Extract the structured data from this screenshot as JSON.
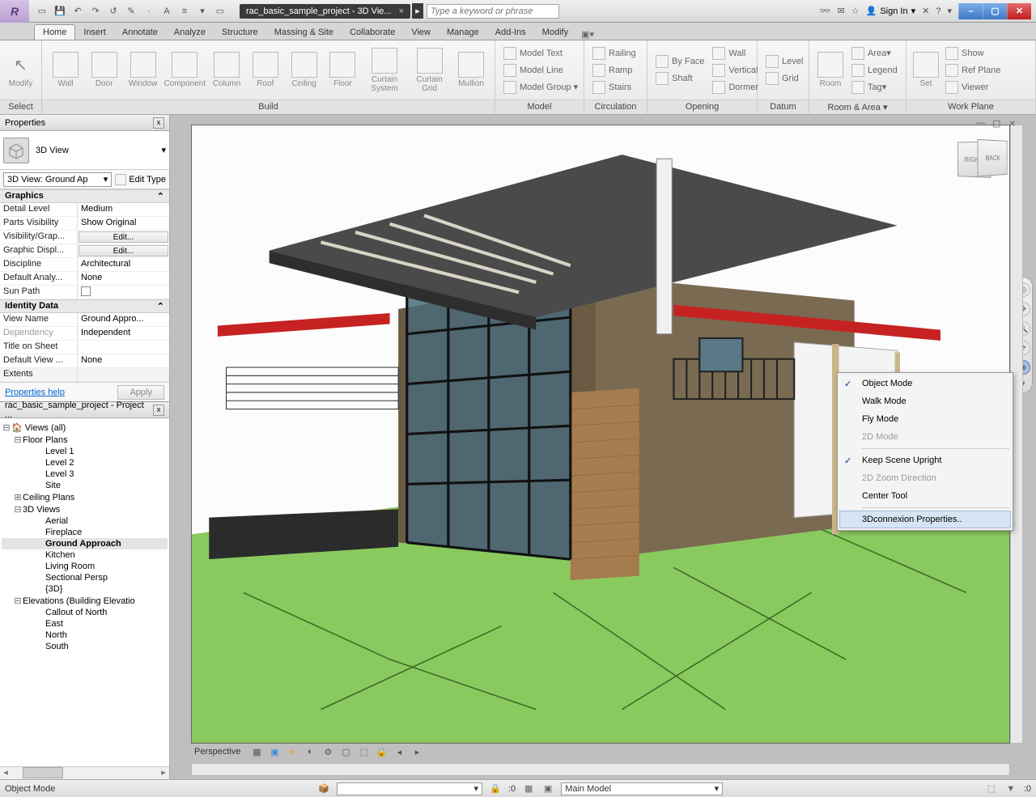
{
  "title_tab": "rac_basic_sample_project - 3D Vie...",
  "search_placeholder": "Type a keyword or phrase",
  "signin": "Sign In",
  "ribbon_tabs": [
    "Home",
    "Insert",
    "Annotate",
    "Analyze",
    "Structure",
    "Massing & Site",
    "Collaborate",
    "View",
    "Manage",
    "Add-Ins",
    "Modify"
  ],
  "ribbon": {
    "select": {
      "modify": "Modify",
      "title": "Select"
    },
    "build": {
      "title": "Build",
      "btns": [
        "Wall",
        "Door",
        "Window",
        "Component",
        "Column",
        "Roof",
        "Ceiling",
        "Floor",
        "Curtain System",
        "Curtain Grid",
        "Mullion"
      ]
    },
    "model": {
      "title": "Model",
      "model_text": "Model Text",
      "model_line": "Model Line",
      "model_group": "Model Group"
    },
    "circulation": {
      "title": "Circulation",
      "railing": "Railing",
      "ramp": "Ramp",
      "stairs": "Stairs"
    },
    "opening": {
      "title": "Opening",
      "byface": "By Face",
      "shaft": "Shaft",
      "wall": "Wall",
      "vertical": "Vertical",
      "dormer": "Dormer"
    },
    "datum": {
      "title": "Datum",
      "level": "Level",
      "grid": "Grid"
    },
    "room_area": {
      "title": "Room & Area",
      "room": "Room",
      "area": "Area",
      "legend": "Legend",
      "tag": "Tag"
    },
    "workplane": {
      "title": "Work Plane",
      "set": "Set",
      "show": "Show",
      "refplane": "Ref Plane",
      "viewer": "Viewer"
    }
  },
  "properties": {
    "title": "Properties",
    "type": "3D View",
    "selector": "3D View: Ground Ap",
    "edit_type": "Edit Type",
    "cat_graphics": "Graphics",
    "rows_graphics": [
      {
        "k": "Detail Level",
        "v": "Medium"
      },
      {
        "k": "Parts Visibility",
        "v": "Show Original"
      },
      {
        "k": "Visibility/Grap...",
        "v": "Edit...",
        "btn": true
      },
      {
        "k": "Graphic Displ...",
        "v": "Edit...",
        "btn": true
      },
      {
        "k": "Discipline",
        "v": "Architectural"
      },
      {
        "k": "Default Analy...",
        "v": "None"
      },
      {
        "k": "Sun Path",
        "v": "",
        "check": true
      }
    ],
    "cat_identity": "Identity Data",
    "rows_identity": [
      {
        "k": "View Name",
        "v": "Ground Appro..."
      },
      {
        "k": "Dependency",
        "v": "Independent",
        "dis": true
      },
      {
        "k": "Title on Sheet",
        "v": ""
      },
      {
        "k": "Default View ...",
        "v": "None"
      }
    ],
    "extents": "Extents",
    "help": "Properties help",
    "apply": "Apply"
  },
  "browser": {
    "title": "rac_basic_sample_project - Project ...",
    "root": "Views (all)",
    "floorplans": "Floor Plans",
    "fp_items": [
      "Level 1",
      "Level 2",
      "Level 3",
      "Site"
    ],
    "ceiling": "Ceiling Plans",
    "views3d": "3D Views",
    "v3d_items": [
      "Aerial",
      "Fireplace",
      "Ground Approach",
      "Kitchen",
      "Living Room",
      "Sectional Persp",
      "{3D}"
    ],
    "elevations": "Elevations (Building Elevatio",
    "elev_items": [
      "Callout of North",
      "East",
      "North",
      "South"
    ]
  },
  "viewcube": {
    "right": "RIGHT",
    "back": "BACK"
  },
  "view_bar": "Perspective",
  "context_menu": {
    "object": "Object Mode",
    "walk": "Walk Mode",
    "fly": "Fly Mode",
    "mode2d": "2D Mode",
    "upright": "Keep Scene Upright",
    "zoom2d": "2D Zoom Direction",
    "center": "Center Tool",
    "props": "3Dconnexion Properties.."
  },
  "status": {
    "mode": "Object Mode",
    "zero": ":0",
    "main_model": "Main Model",
    "filter_zero": ":0"
  }
}
